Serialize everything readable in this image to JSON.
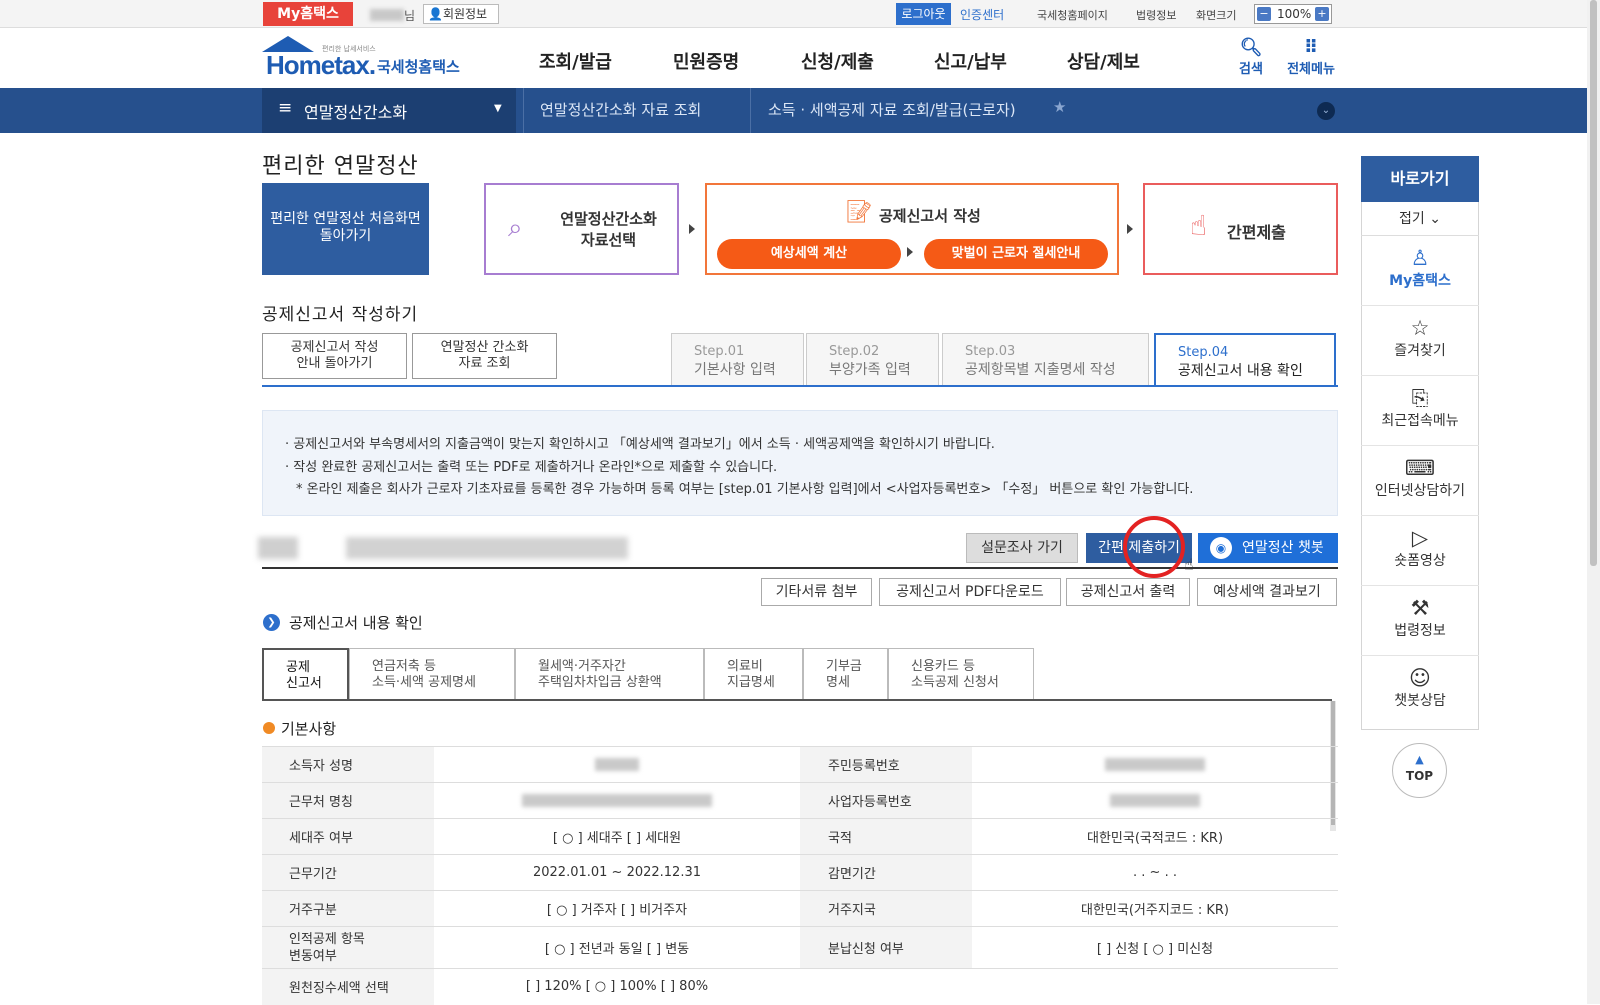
{
  "topbar": {
    "brand_my": "My홈택스",
    "user_suffix": "님",
    "member_info": "👤회원정보",
    "logout": "로그아웃",
    "cert_center": "인증센터",
    "links": [
      "국세청홈페이지",
      "법령정보",
      "화면크기"
    ],
    "zoom": "100%"
  },
  "brand": {
    "small": "편리한 납세서비스",
    "name": "Hometax.",
    "sub": "국세청홈택스"
  },
  "gnb": [
    "조회/발급",
    "민원증명",
    "신청/제출",
    "신고/납부",
    "상담/제보"
  ],
  "header_icons": {
    "search": "검색",
    "all_menu": "전체메뉴"
  },
  "navbar": {
    "main": "연말정산간소화",
    "crumb1": "연말정산간소화 자료 조회",
    "crumb2": "소득 · 세액공제 자료 조회/발급(근로자)"
  },
  "page_title": "편리한 연말정산",
  "process": {
    "home_line1": "편리한 연말정산 처음화면",
    "home_line2": "돌아가기",
    "select_line1": "연말정산간소화",
    "select_line2": "자료선택",
    "write": "공제신고서 작성",
    "estimate": "예상세액 계산",
    "tips": "맞벌이 근로자 절세안내",
    "simple": "간편제출"
  },
  "section_title": "공제신고서 작성하기",
  "sub_buttons": [
    {
      "l1": "공제신고서 작성",
      "l2": "안내 돌아가기"
    },
    {
      "l1": "연말정산 간소화",
      "l2": "자료 조회"
    }
  ],
  "steps": [
    {
      "step": "Step.01",
      "name": "기본사항 입력"
    },
    {
      "step": "Step.02",
      "name": "부양가족 입력"
    },
    {
      "step": "Step.03",
      "name": "공제항목별 지출명세 작성"
    },
    {
      "step": "Step.04",
      "name": "공제신고서 내용 확인"
    }
  ],
  "notices": [
    "· 공제신고서와 부속명세서의 지출금액이 맞는지 확인하시고 「예상세액 결과보기」에서 소득 · 세액공제액을 확인하시기 바랍니다.",
    "· 작성 완료한 공제신고서는 출력 또는 PDF로 제출하거나 온라인*으로 제출할 수 있습니다.",
    "* 온라인 제출은 회사가 근로자 기초자료를 등록한 경우 가능하며 등록 여부는 [step.01 기본사항 입력]에서 <사업자등록번호> 「수정」 버튼으로 확인 가능합니다."
  ],
  "actions": {
    "survey": "설문조사 가기",
    "simple_submit": "간편 제출하기",
    "chatbot": "연말정산 챗봇",
    "attach": "기타서류 첨부",
    "pdf": "공제신고서 PDF다운로드",
    "print": "공제신고서 출력",
    "result": "예상세액 결과보기"
  },
  "confirm_title": "공제신고서 내용 확인",
  "doc_tabs": [
    {
      "l1": "공제",
      "l2": "신고서"
    },
    {
      "l1": "연금저축 등",
      "l2": "소득·세액 공제명세"
    },
    {
      "l1": "월세액·거주자간",
      "l2": "주택임차차입금 상환액"
    },
    {
      "l1": "의료비",
      "l2": "지급명세"
    },
    {
      "l1": "기부금",
      "l2": "명세"
    },
    {
      "l1": "신용카드 등",
      "l2": "소득공제 신청서"
    }
  ],
  "basic_title": "기본사항",
  "info": {
    "name_label": "소득자 성명",
    "rrn_label": "주민등록번호",
    "workplace_label": "근무처 명칭",
    "bizno_label": "사업자등록번호",
    "household_label": "세대주 여부",
    "household_value": "[ ○ ] 세대주   [    ] 세대원",
    "nationality_label": "국적",
    "nationality_value": "대한민국(국적코드 : KR)",
    "period_label": "근무기간",
    "period_value": "2022.01.01 ~ 2022.12.31",
    "reduction_label": "감면기간",
    "reduction_value": ". . ~ . .",
    "residence_label": "거주구분",
    "residence_value": "[ ○ ] 거주자   [    ] 비거주자",
    "region_label": "거주지국",
    "region_value": "대한민국(거주지코드 : KR)",
    "change_label1": "인적공제 항목",
    "change_label2": "변동여부",
    "change_value": "[ ○ ] 전년과 동일   [    ] 변동",
    "installment_label": "분납신청 여부",
    "installment_value": "[    ] 신청  [ ○ ] 미신청",
    "withholding_label": "원천징수세액 선택",
    "withholding_value": "[    ] 120%   [ ○ ] 100%  [    ] 80%"
  },
  "quick": {
    "title": "바로가기",
    "fold": "접기 ⌄",
    "items": [
      {
        "label": "My홈택스",
        "icon": "person-icon"
      },
      {
        "label": "즐겨찾기",
        "icon": "star-icon"
      },
      {
        "label": "최근접속메뉴",
        "icon": "recent-icon"
      },
      {
        "label": "인터넷상담하기",
        "icon": "laptop-icon"
      },
      {
        "label": "숏폼영상",
        "icon": "play-icon"
      },
      {
        "label": "법령정보",
        "icon": "gavel-icon"
      },
      {
        "label": "챗봇상담",
        "icon": "chatbot-icon"
      }
    ],
    "top": "TOP"
  },
  "colors": {
    "nav": "#26508d",
    "accent": "#2d6fcc",
    "orange": "#f55a16",
    "brand_red": "#e8433a"
  }
}
